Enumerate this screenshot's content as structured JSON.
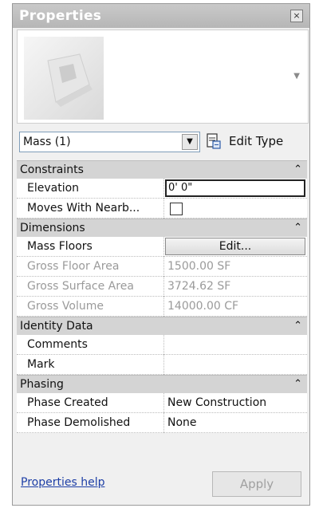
{
  "window": {
    "title": "Properties",
    "close_glyph": "×"
  },
  "type_selector": {
    "value": "Mass (1)",
    "dropdown_glyph": "▼"
  },
  "edit_type": {
    "label": "Edit Type",
    "icon": "edit-type-icon"
  },
  "categories": {
    "constraints": {
      "label": "Constraints",
      "collapse_glyph": "«",
      "elevation": {
        "label": "Elevation",
        "value": "0'  0\""
      },
      "moves_with": {
        "label": "Moves With Nearb...",
        "checked": false
      }
    },
    "dimensions": {
      "label": "Dimensions",
      "collapse_glyph": "«",
      "mass_floors": {
        "label": "Mass Floors",
        "button": "Edit..."
      },
      "gross_floor_area": {
        "label": "Gross Floor Area",
        "value": "1500.00 SF"
      },
      "gross_surface_area": {
        "label": "Gross Surface Area",
        "value": "3724.62 SF"
      },
      "gross_volume": {
        "label": "Gross Volume",
        "value": "14000.00 CF"
      }
    },
    "identity": {
      "label": "Identity Data",
      "collapse_glyph": "«",
      "comments": {
        "label": "Comments",
        "value": ""
      },
      "mark": {
        "label": "Mark",
        "value": ""
      }
    },
    "phasing": {
      "label": "Phasing",
      "collapse_glyph": "«",
      "phase_created": {
        "label": "Phase Created",
        "value": "New Construction"
      },
      "phase_demolished": {
        "label": "Phase Demolished",
        "value": "None"
      }
    }
  },
  "footer": {
    "help_link": "Properties help",
    "apply_button": "Apply"
  }
}
